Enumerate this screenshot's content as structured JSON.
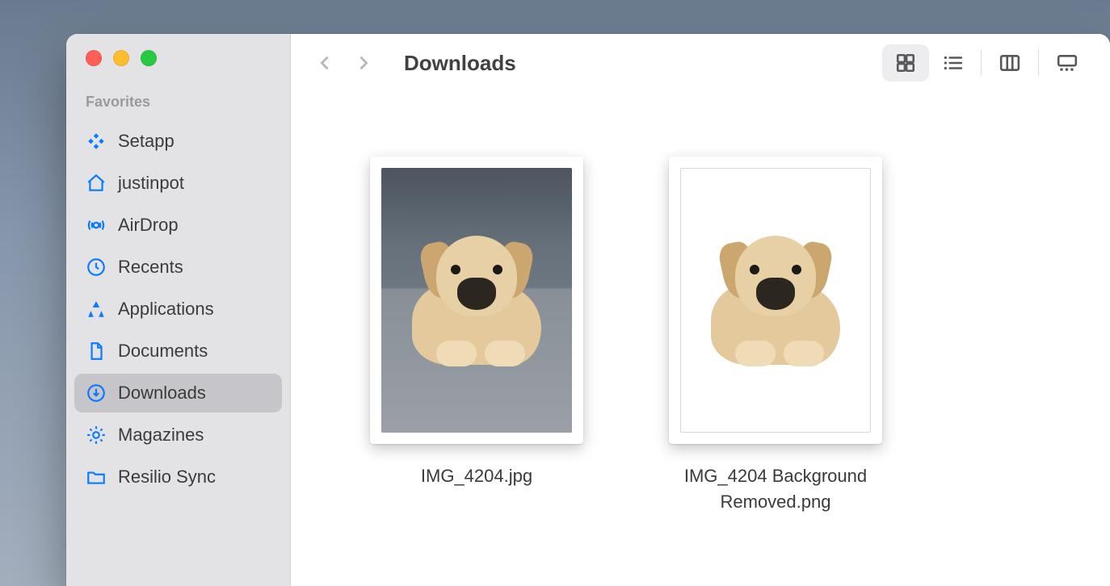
{
  "window_title": "Downloads",
  "sidebar": {
    "header": "Favorites",
    "items": [
      {
        "icon": "setapp-icon",
        "label": "Setapp"
      },
      {
        "icon": "home-icon",
        "label": "justinpot"
      },
      {
        "icon": "airdrop-icon",
        "label": "AirDrop"
      },
      {
        "icon": "clock-icon",
        "label": "Recents"
      },
      {
        "icon": "apps-icon",
        "label": "Applications"
      },
      {
        "icon": "document-icon",
        "label": "Documents"
      },
      {
        "icon": "download-icon",
        "label": "Downloads",
        "selected": true
      },
      {
        "icon": "gear-icon",
        "label": "Magazines"
      },
      {
        "icon": "folder-icon",
        "label": "Resilio Sync"
      }
    ]
  },
  "files": [
    {
      "name": "IMG_4204.jpg",
      "kind": "jpg"
    },
    {
      "name": "IMG_4204 Background Removed.png",
      "kind": "png"
    }
  ]
}
